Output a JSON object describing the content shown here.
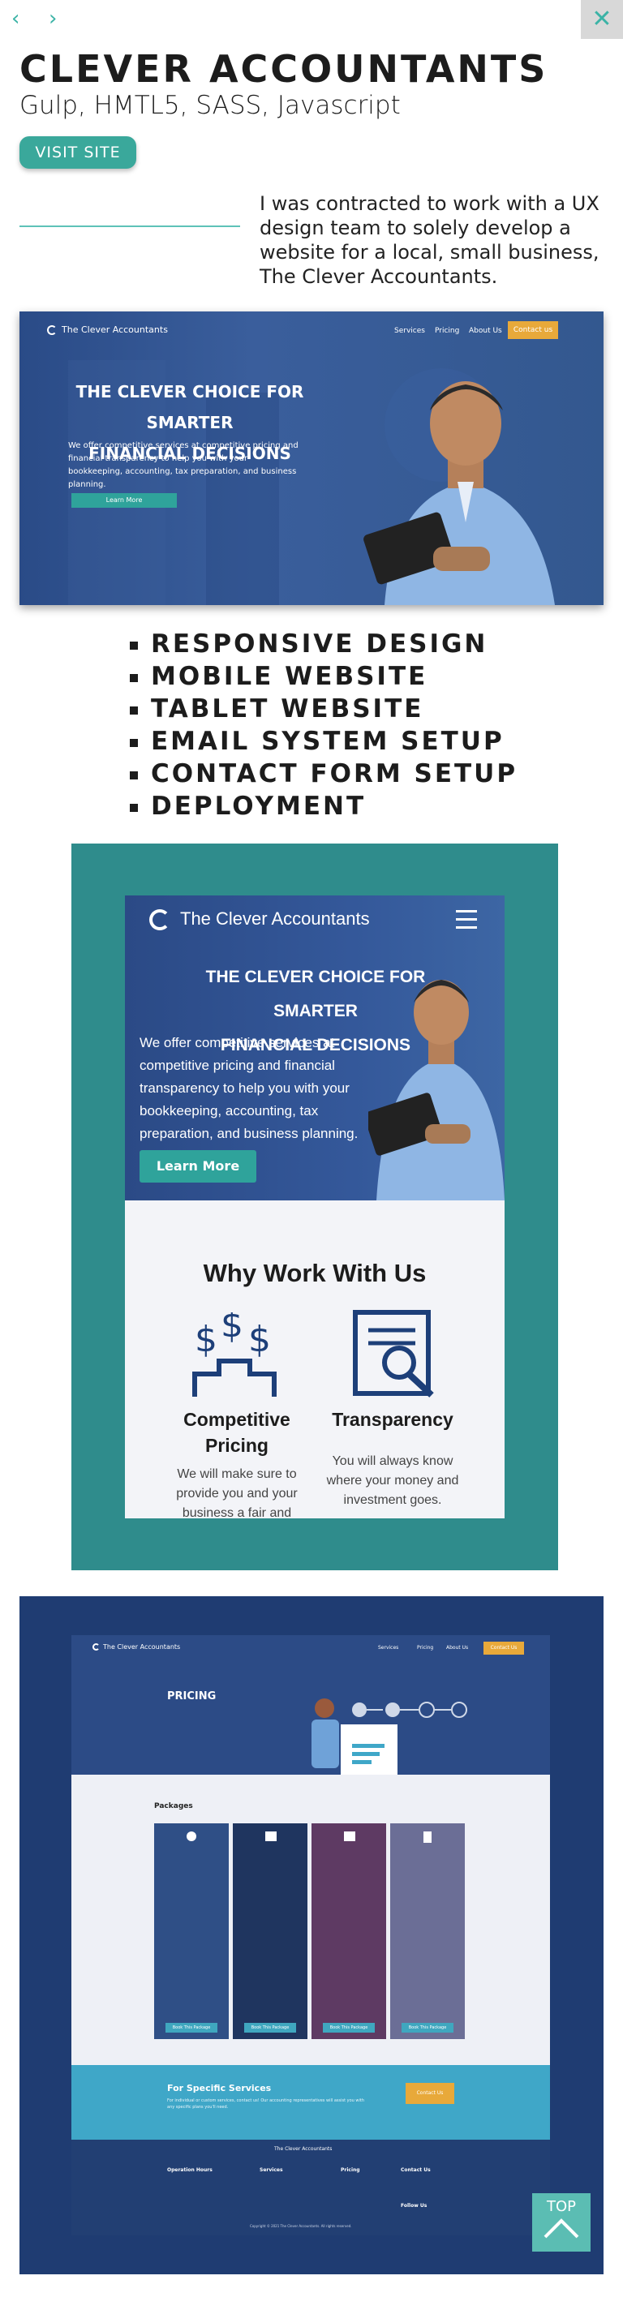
{
  "nav": {
    "prev_icon": "chevron-left-icon",
    "next_icon": "chevron-right-icon",
    "close_icon": "close-icon",
    "prev": "‹",
    "next": "›",
    "close": "✕"
  },
  "project": {
    "title": "CLEVER ACCOUNTANTS",
    "subtitle": "Gulp, HMTL5, SASS, Javascript",
    "visit_label": "VISIT SITE",
    "description": "I was contracted to work with a UX design team to solely develop a website for a local, small business, The Clever Accountants."
  },
  "site_preview": {
    "logo_text": "The Clever Accountants",
    "nav_links": [
      "Services",
      "Pricing",
      "About Us"
    ],
    "contact_label": "Contact us",
    "headline_1": "THE CLEVER CHOICE FOR SMARTER",
    "headline_2": "FINANCIAL DECISIONS",
    "body": "We offer competitive services at competitive pricing and financial transparency to help you with your bookkeeping, accounting, tax preparation, and business planning.",
    "cta": "Learn More"
  },
  "features": [
    "RESPONSIVE DESIGN",
    "MOBILE WEBSITE",
    "TABLET WEBSITE",
    "EMAIL SYSTEM SETUP",
    "CONTACT FORM SETUP",
    "DEPLOYMENT"
  ],
  "mobile_preview": {
    "logo_text": "The Clever Accountants",
    "menu_icon": "hamburger-icon",
    "headline_1": "THE CLEVER CHOICE FOR SMARTER",
    "headline_2": "FINANCIAL DECISIONS",
    "body": "We offer competitive services at competitive pricing and financial transparency to help you with your bookkeeping, accounting, tax preparation, and business planning.",
    "cta": "Learn More",
    "why_title": "Why Work With Us",
    "col1_title": "Competitive Pricing",
    "col1_text": "We will make sure to provide you and your business a fair and",
    "col2_title": "Transparency",
    "col2_text": "You will always know where your money and investment goes."
  },
  "pricing_preview": {
    "logo_text": "The Clever Accountants",
    "nav_links": [
      "Services",
      "Pricing",
      "About Us"
    ],
    "contact_label": "Contact Us",
    "hero_title": "PRICING",
    "packages_title": "Packages",
    "package_colors": [
      "#2f4f86",
      "#1f355f",
      "#5e3a63",
      "#6b6e96"
    ],
    "package_button": "Book This Package",
    "specific_title": "For Specific Services",
    "specific_text": "For individual or custom services, contact us! Our accounting representatives will assist you with any specific plans you'll need.",
    "specific_button": "Contact Us",
    "footer_logo": "The Clever Accountants",
    "footer_cols": [
      "Operation Hours",
      "Services",
      "Pricing",
      "Contact Us"
    ],
    "footer_follow": "Follow Us",
    "copyright": "Copyright © 2021 The Clever Accountants. All rights reserved."
  },
  "top_button": {
    "label": "TOP",
    "icon": "chevron-up-icon"
  },
  "colors": {
    "teal": "#3aa89b",
    "teal_frame": "#2f8c8c",
    "navy": "#1f3c72",
    "hero_blue": "#2e4f8d",
    "accent_orange": "#e8a93a"
  }
}
